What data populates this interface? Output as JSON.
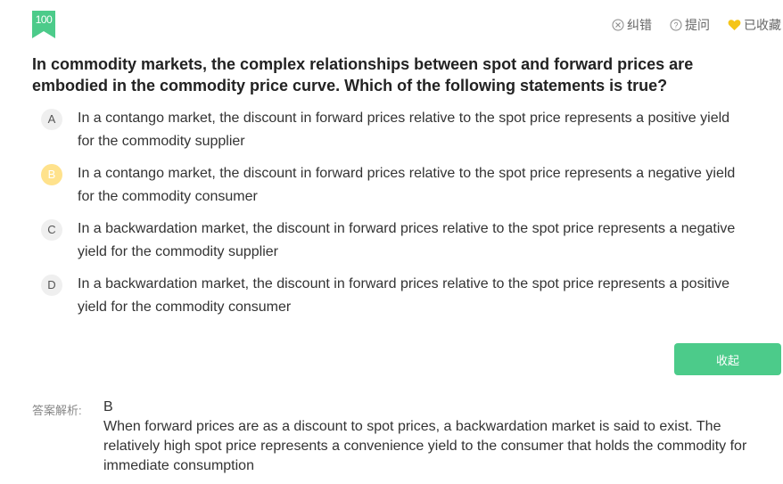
{
  "badge": {
    "number": "100",
    "color": "#4ccb8a"
  },
  "toolbar": {
    "report_label": "纠错",
    "ask_label": "提问",
    "favorite_label": "已收藏",
    "favorite_color": "#f5c518"
  },
  "question": {
    "text": "In commodity markets, the complex relationships between spot and forward prices are embodied in the commodity price curve. Which of the following statements is true?"
  },
  "options": [
    {
      "letter": "A",
      "text": "In a contango market, the discount in forward prices relative to the spot price represents a positive yield for the commodity supplier",
      "selected": false
    },
    {
      "letter": "B",
      "text": "In a contango market, the discount in forward prices relative to the spot price represents a negative yield for the commodity consumer",
      "selected": true
    },
    {
      "letter": "C",
      "text": "In a backwardation market, the discount in forward prices relative to the spot price represents a negative yield for the commodity supplier",
      "selected": false
    },
    {
      "letter": "D",
      "text": "In a backwardation market, the discount in forward prices relative to the spot price represents a positive yield for the commodity consumer",
      "selected": false
    }
  ],
  "collapse_button": {
    "label": "收起",
    "color": "#4ccb8a"
  },
  "analysis": {
    "label": "答案解析:",
    "answer": "B",
    "text": "When forward prices are as a discount to spot prices, a backwardation market is said to exist. The relatively high spot price represents a convenience yield to the consumer that holds the commodity for immediate consumption"
  }
}
